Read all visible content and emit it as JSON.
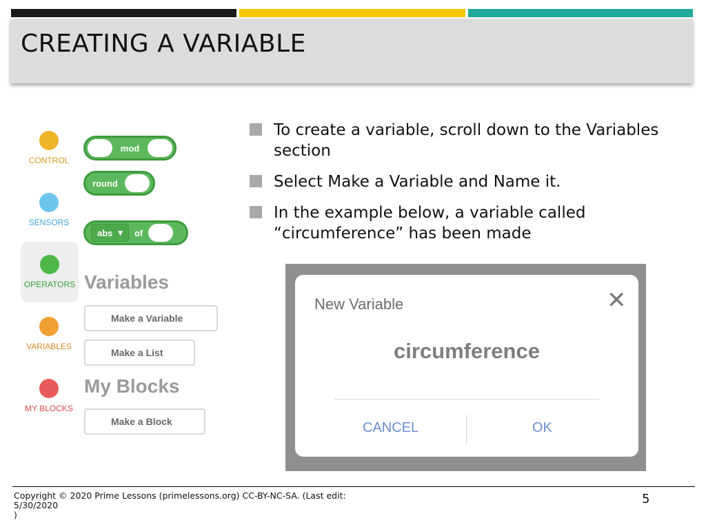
{
  "slide": {
    "title": "CREATING A VARIABLE",
    "page_number": "5",
    "copyright": "Copyright © 2020 Prime Lessons (primelessons.org) CC-BY-NC-SA.  (Last edit: 5/30/2020\n)"
  },
  "accent_colors": {
    "black": "#1a1a1a",
    "yellow": "#f5c800",
    "teal": "#1fa99a"
  },
  "bullets": [
    "To create a variable, scroll down to the Variables section",
    "Select Make a Variable and Name it.",
    "In the example below, a variable called “circumference” has been made"
  ],
  "palette": {
    "categories": [
      {
        "label": "CONTROL",
        "color": "#f0b429",
        "label_color": "#d69a1f"
      },
      {
        "label": "SENSORS",
        "color": "#6ec6ee",
        "label_color": "#3fa3d3"
      },
      {
        "label": "OPERATORS",
        "color": "#4db848",
        "label_color": "#3a9f36",
        "selected": true
      },
      {
        "label": "VARIABLES",
        "color": "#f0a033",
        "label_color": "#d6892a"
      },
      {
        "label": "MY BLOCKS",
        "color": "#e85a5a",
        "label_color": "#d84a4a"
      }
    ],
    "blocks": {
      "mod": "mod",
      "round": "round",
      "abs": "abs",
      "abs_arrow": "▾",
      "of": "of"
    },
    "variables_heading": "Variables",
    "make_variable": "Make a Variable",
    "make_list": "Make a List",
    "myblocks_heading": "My Blocks",
    "make_block": "Make a Block"
  },
  "dialog": {
    "title": "New Variable",
    "close_glyph": "✕",
    "value": "circumference",
    "cancel": "CANCEL",
    "ok": "OK"
  }
}
